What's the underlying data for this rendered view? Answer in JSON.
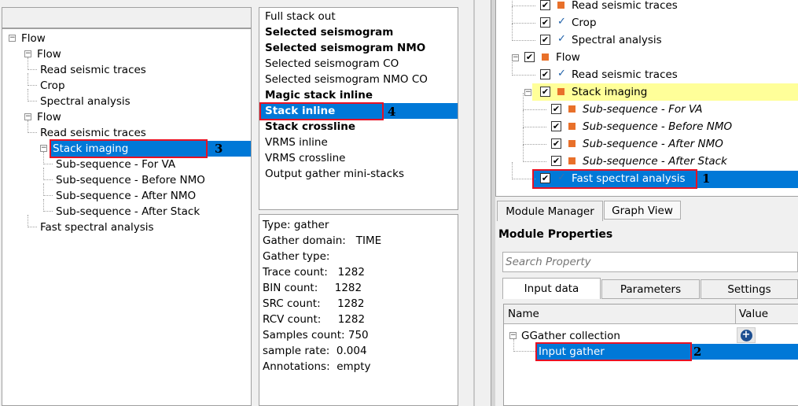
{
  "left_tree": {
    "items": [
      {
        "label": "Flow",
        "level": 0
      },
      {
        "label": "Flow",
        "level": 1
      },
      {
        "label": "Read seismic traces",
        "level": 2
      },
      {
        "label": "Crop",
        "level": 2
      },
      {
        "label": "Spectral analysis",
        "level": 2
      },
      {
        "label": "Flow",
        "level": 1
      },
      {
        "label": "Read seismic traces",
        "level": 2
      },
      {
        "label": "Stack imaging",
        "level": 2,
        "selected": true
      },
      {
        "label": "Sub-sequence - For VA",
        "level": 3
      },
      {
        "label": "Sub-sequence - Before NMO",
        "level": 3
      },
      {
        "label": "Sub-sequence - After NMO",
        "level": 3
      },
      {
        "label": "Sub-sequence - After Stack",
        "level": 3
      },
      {
        "label": "Fast spectral analysis",
        "level": 2
      }
    ],
    "annotation": "3"
  },
  "output_list": {
    "items": [
      {
        "label": "Full stack out",
        "bold": false
      },
      {
        "label": "Selected seismogram",
        "bold": true
      },
      {
        "label": "Selected seismogram NMO",
        "bold": true
      },
      {
        "label": "Selected seismogram CO",
        "bold": false
      },
      {
        "label": "Selected seismogram NMO CO",
        "bold": false
      },
      {
        "label": "Magic stack inline",
        "bold": true
      },
      {
        "label": "Stack inline",
        "bold": true,
        "selected": true
      },
      {
        "label": "Stack crossline",
        "bold": true
      },
      {
        "label": "VRMS inline",
        "bold": false
      },
      {
        "label": "VRMS crossline",
        "bold": false
      },
      {
        "label": "Output gather mini-stacks",
        "bold": false
      }
    ],
    "annotation": "4"
  },
  "info": {
    "lines": [
      "Type: gather",
      "Gather domain:   TIME",
      "Gather type:",
      "Trace count:   1282",
      "BIN count:     1282",
      "SRC count:     1282",
      "RCV count:     1282",
      "Samples count: 750",
      "sample rate:  0.004",
      "Annotations:  empty"
    ]
  },
  "right_tree": {
    "items": [
      {
        "label": "Read seismic traces",
        "level": 2,
        "status": "orange-square"
      },
      {
        "label": "Crop",
        "level": 2,
        "status": "check"
      },
      {
        "label": "Spectral analysis",
        "level": 2,
        "status": "check"
      },
      {
        "label": "Flow",
        "level": 1,
        "status": "orange-square"
      },
      {
        "label": "Read seismic traces",
        "level": 2,
        "status": "check"
      },
      {
        "label": "Stack imaging",
        "level": 2,
        "status": "orange-square",
        "highlight": true
      },
      {
        "label": "Sub-sequence - For VA",
        "level": 3,
        "status": "orange-square",
        "italic": true
      },
      {
        "label": "Sub-sequence - Before NMO",
        "level": 3,
        "status": "orange-square",
        "italic": true
      },
      {
        "label": "Sub-sequence - After NMO",
        "level": 3,
        "status": "orange-square",
        "italic": true
      },
      {
        "label": "Sub-sequence - After Stack",
        "level": 3,
        "status": "orange-square",
        "italic": true
      },
      {
        "label": "Fast spectral analysis",
        "level": 2,
        "status": "check",
        "selected": true
      }
    ],
    "annotation": "1"
  },
  "tabs": {
    "module_manager": "Module Manager",
    "graph_view": "Graph View"
  },
  "module_properties": {
    "title": "Module Properties",
    "search_placeholder": "Search Property",
    "tabs": [
      "Input data",
      "Parameters",
      "Settings"
    ],
    "columns": [
      "Name",
      "Value"
    ],
    "group": "GGather collection",
    "item": "Input gather",
    "annotation": "2"
  },
  "colors": {
    "selection": "#0078d7",
    "highlight": "#ffff99",
    "annotation_box": "#e81123",
    "status_square": "#e8702a"
  }
}
